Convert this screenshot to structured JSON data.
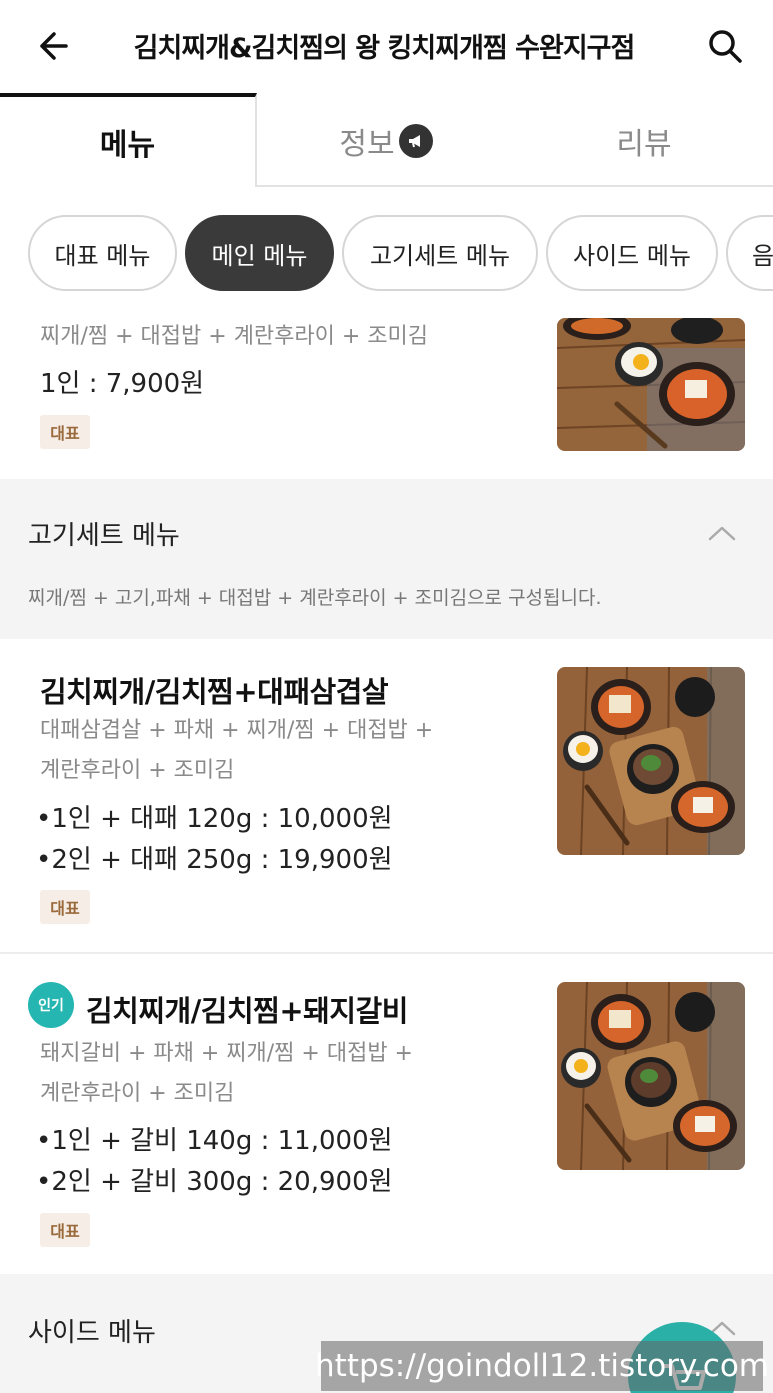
{
  "header": {
    "title": "김치찌개&김치찜의 왕 킹치찌개찜 수완지구점"
  },
  "tabs": [
    {
      "label": "메뉴"
    },
    {
      "label": "정보"
    },
    {
      "label": "리뷰"
    }
  ],
  "chips": [
    {
      "label": "대표 메뉴"
    },
    {
      "label": "메인 메뉴"
    },
    {
      "label": "고기세트 메뉴"
    },
    {
      "label": "사이드 메뉴"
    },
    {
      "label": "음"
    }
  ],
  "partial_item": {
    "desc": "찌개/찜 + 대접밥 + 계란후라이 + 조미김",
    "price": "1인 : 7,900원",
    "tag": "대표"
  },
  "sections": [
    {
      "title": "고기세트 메뉴",
      "desc": "찌개/찜 + 고기,파채 + 대접밥 + 계란후라이 + 조미김으로 구성됩니다."
    },
    {
      "title": "사이드 메뉴"
    }
  ],
  "items": [
    {
      "name": "김치찌개/김치찜+대패삼겹살",
      "desc_lines": [
        "대패삼겹살 + 파채 + 찌개/찜 + 대접밥 +",
        "계란후라이 + 조미김"
      ],
      "prices": [
        "•1인 + 대패 120g : 10,000원",
        "•2인 + 대패 250g : 19,900원"
      ],
      "tag": "대표"
    },
    {
      "badge": "인기",
      "name": "김치찌개/김치찜+돼지갈비",
      "desc_lines": [
        "돼지갈비 + 파채 + 찌개/찜 + 대접밥 +",
        "계란후라이 + 조미김"
      ],
      "prices": [
        "•1인 + 갈비 140g : 11,000원",
        "•2인 + 갈비 300g : 20,900원"
      ],
      "tag": "대표"
    }
  ],
  "watermark": "https://goindoll12.tistory.com",
  "colors": {
    "active_chip_bg": "#3a3a3a",
    "tag_bg": "#f5ede6",
    "tag_text": "#9a6a3c",
    "popular_badge": "#26b6b1",
    "section_bg": "#f4f4f4"
  }
}
